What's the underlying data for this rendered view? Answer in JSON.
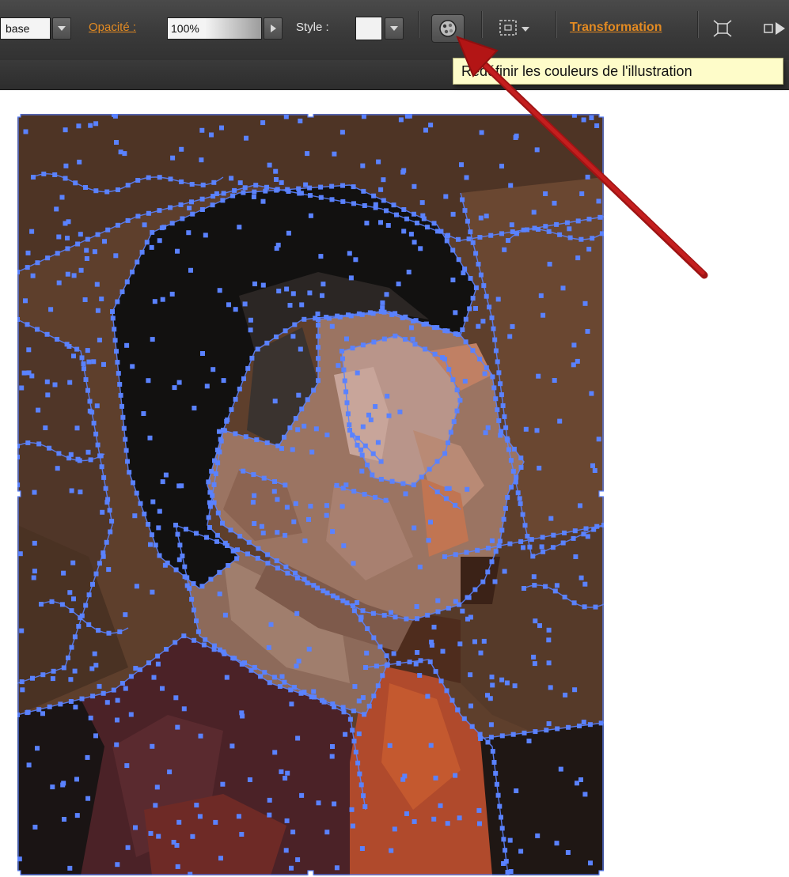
{
  "control_bar": {
    "blend_mode_value": "base",
    "opacity_label": "Opacité :",
    "opacity_value": "100%",
    "style_label": "Style :",
    "recolor_button_icon": "color-wheel-icon",
    "transform_label": "Transformation",
    "tool_icons": [
      "align-selection-icon",
      "transform-each-icon",
      "reflect-icon"
    ]
  },
  "tooltip": {
    "text": "Redéfinir les couleurs de l'illustration"
  },
  "artwork": {
    "description_colors": {
      "background": "#5e3f2c",
      "hair": "#121110",
      "skin_light": "#b9958a",
      "skin_mid": "#9b7462",
      "shirt_dark": "#4b2227",
      "shirt_orange": "#b04a2c",
      "anchor_blue": "#5a82ff"
    }
  },
  "annotation": {
    "arrow_color": "#b31515"
  }
}
